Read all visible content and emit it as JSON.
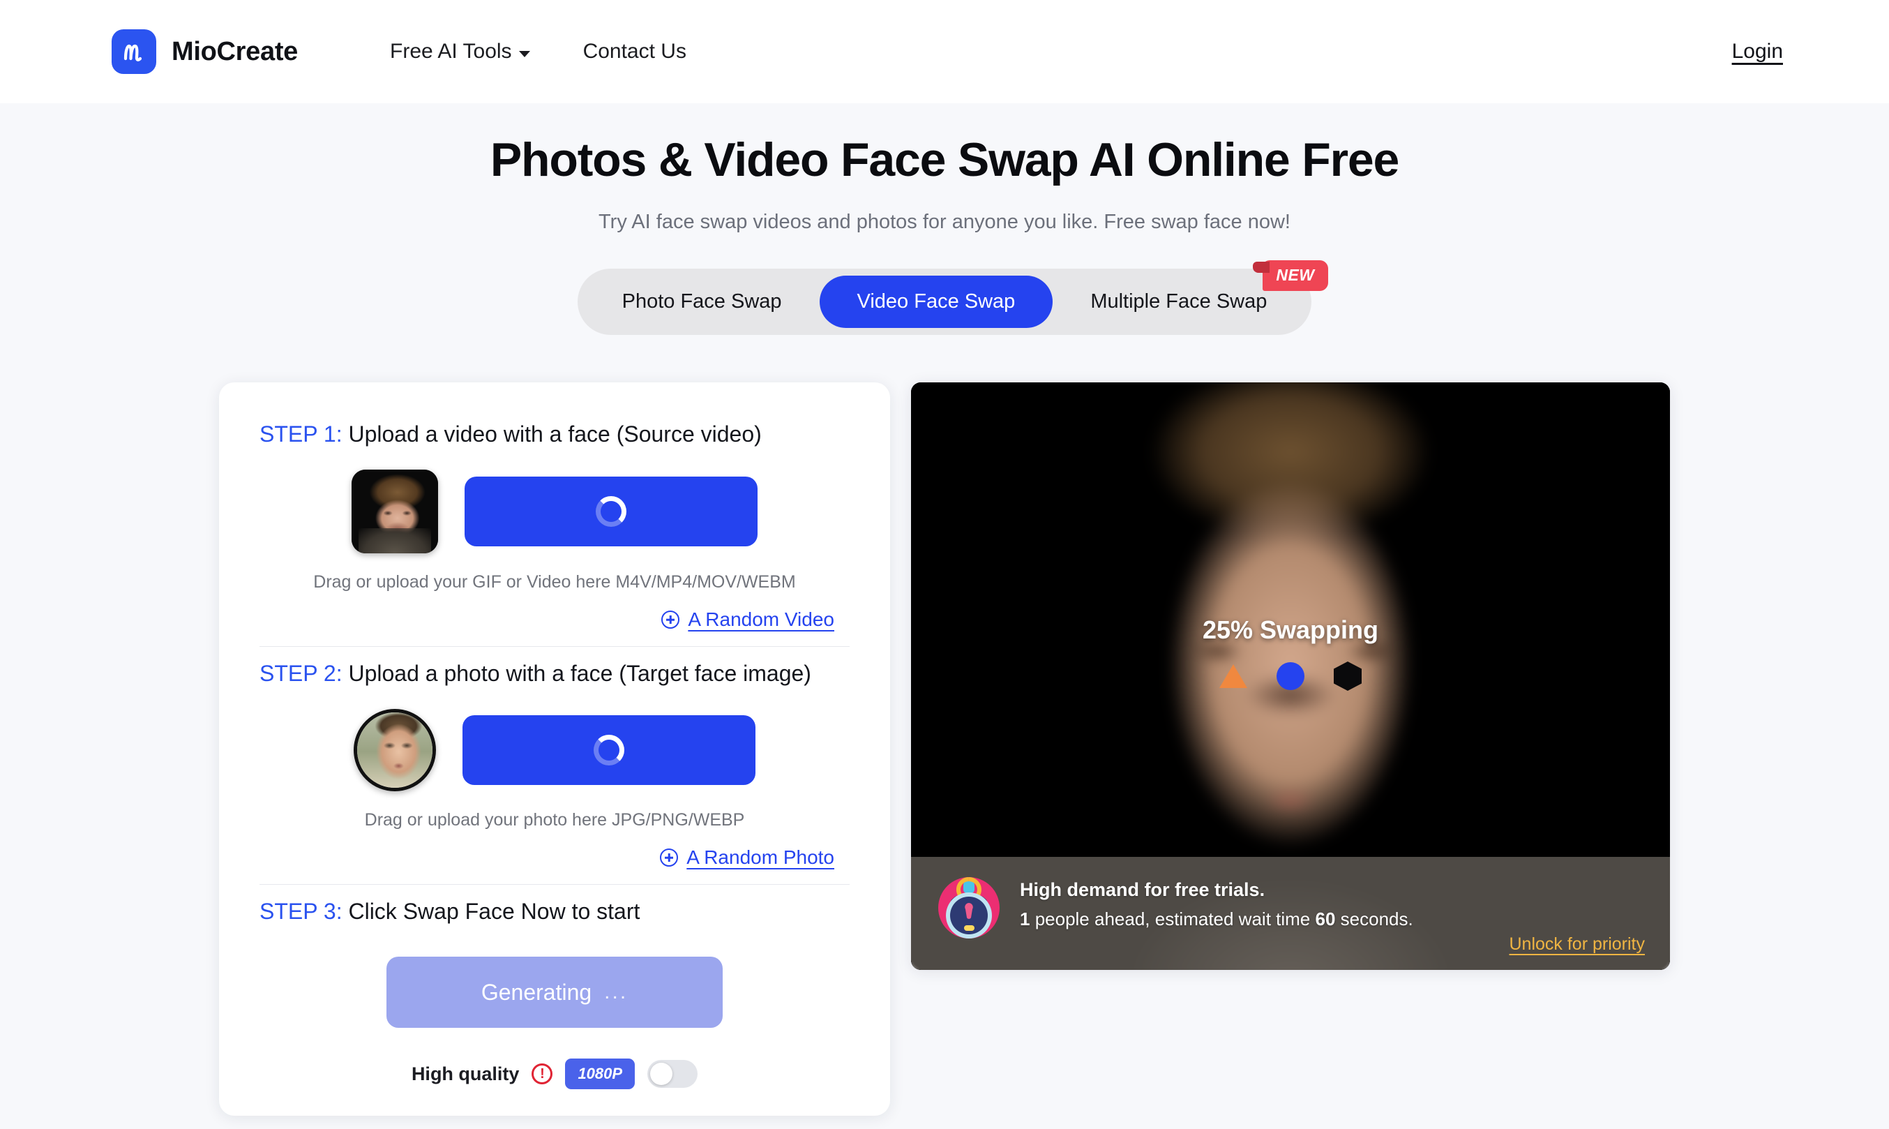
{
  "header": {
    "brand_name": "MioCreate",
    "nav": [
      {
        "label": "Free AI Tools",
        "has_caret": true
      },
      {
        "label": "Contact Us",
        "has_caret": false
      }
    ],
    "login_label": "Login"
  },
  "hero": {
    "title": "Photos & Video Face Swap AI Online Free",
    "subtitle": "Try AI face swap videos and photos for anyone you like. Free swap face now!"
  },
  "tabs": {
    "items": [
      {
        "label": "Photo Face Swap",
        "active": false
      },
      {
        "label": "Video Face Swap",
        "active": true
      },
      {
        "label": "Multiple Face Swap",
        "active": false
      }
    ],
    "badge": "NEW"
  },
  "steps": {
    "step1": {
      "label": "STEP 1:",
      "text": "Upload a video with a face (Source video)",
      "hint": "Drag or upload your GIF or Video here M4V/MP4/MOV/WEBM",
      "random_link": "A Random Video"
    },
    "step2": {
      "label": "STEP 2:",
      "text": "Upload a photo with a face (Target face image)",
      "hint": "Drag or upload your photo here JPG/PNG/WEBP",
      "random_link": "A Random Photo"
    },
    "step3": {
      "label": "STEP 3:",
      "text": "Click Swap Face Now to start",
      "generate_label": "Generating",
      "generate_dots": "...",
      "quality_label": "High quality",
      "warn_glyph": "!",
      "resolution": "1080P",
      "toggle_on": false
    }
  },
  "preview": {
    "status": "25% Swapping",
    "notice_title": "High demand for free trials.",
    "notice_queue_count": "1",
    "notice_mid": " people ahead, estimated wait time ",
    "notice_wait_seconds": "60",
    "notice_end": " seconds.",
    "unlock_label": "Unlock for priority"
  },
  "colors": {
    "brand_blue": "#2543ef",
    "generating_blue": "#9ba6ee",
    "badge_red": "#ef4554",
    "unlock_gold": "#f0b542",
    "warn_red": "#e02434"
  }
}
